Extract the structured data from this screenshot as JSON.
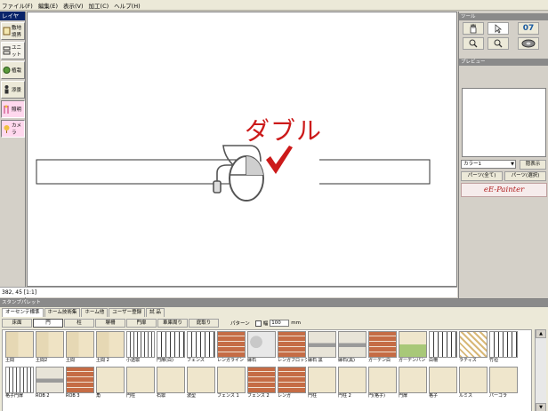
{
  "menu": [
    "ファイル(F)",
    "編集(E)",
    "表示(V)",
    "加工(C)",
    "ヘルプ(H)"
  ],
  "left_panel": {
    "title": "レイヤ",
    "tools": [
      {
        "label": "敷地境界",
        "icon": "site-icon"
      },
      {
        "label": "ユニット",
        "icon": "unit-icon"
      },
      {
        "label": "植栽",
        "icon": "plant-icon"
      },
      {
        "label": "添景",
        "icon": "figure-icon"
      },
      {
        "label": "照明",
        "icon": "light-icon"
      },
      {
        "label": "カメラ",
        "icon": "camera-icon"
      }
    ]
  },
  "canvas": {
    "annotation": "ダブル",
    "annotation_color": "#cc1a1a"
  },
  "status_bar": "382, 45 [1:1]",
  "right_panel": {
    "tools_title": "ツール",
    "zoom_value": "07",
    "preview_title": "プレビュー",
    "layer_select": "カラー1",
    "hide_button": "隠表示",
    "part_all_button": "パーツ(全て)",
    "part_select_button": "パーツ(選択)",
    "brand": "eE-Painter"
  },
  "stamp_panel": {
    "title": "スタンプパレット",
    "tabs": [
      "オーセンテ標準",
      "ホーム技術集",
      "ホーム他",
      "ユーザー登録",
      "試 品"
    ],
    "categories": [
      "床面",
      "門",
      "柱",
      "塀柵",
      "門扉",
      "車庫周り",
      "庭取り"
    ],
    "pattern_label": "パターン",
    "width_label": "幅",
    "width_value": "100",
    "unit": "mm",
    "stamps_row1": [
      {
        "label": "土間",
        "pattern": "p-tile"
      },
      {
        "label": "土間2",
        "pattern": "p-tile"
      },
      {
        "label": "土間",
        "pattern": "p-tile"
      },
      {
        "label": "土間 2",
        "pattern": "p-tile"
      },
      {
        "label": "小透塀",
        "pattern": "p-hatch"
      },
      {
        "label": "門扉(白)",
        "pattern": "p-fence"
      },
      {
        "label": "フェンス",
        "pattern": "p-fence"
      },
      {
        "label": "レンガライン",
        "pattern": "p-brick"
      },
      {
        "label": "縁石",
        "pattern": "p-stone"
      },
      {
        "label": "レンガブロック",
        "pattern": "p-brick"
      },
      {
        "label": "縁石 黒",
        "pattern": "p-gray"
      },
      {
        "label": "縁石(黒)",
        "pattern": "p-gray"
      },
      {
        "label": "ガーデン白",
        "pattern": "p-brick"
      },
      {
        "label": "ガーデンパン",
        "pattern": "p-green"
      },
      {
        "label": "白柵",
        "pattern": "p-fence"
      },
      {
        "label": "ラティス",
        "pattern": "p-lattice"
      },
      {
        "label": "竹垣",
        "pattern": "p-fence"
      }
    ],
    "stamps_row2": [
      {
        "label": "格子門扉",
        "pattern": "p-hatch"
      },
      {
        "label": "ROB 2",
        "pattern": "p-gray"
      },
      {
        "label": "ROB 3",
        "pattern": "p-brick"
      },
      {
        "label": "角",
        "pattern": "p-beige"
      },
      {
        "label": "門柱",
        "pattern": "p-beige"
      },
      {
        "label": "石塀",
        "pattern": "p-beige"
      },
      {
        "label": "波型",
        "pattern": "p-beige"
      },
      {
        "label": "フェンス 1",
        "pattern": "p-beige"
      },
      {
        "label": "フェンス 2",
        "pattern": "p-brick"
      },
      {
        "label": "レンガ",
        "pattern": "p-brick"
      },
      {
        "label": "門柱",
        "pattern": "p-beige"
      },
      {
        "label": "門柱 2",
        "pattern": "p-beige"
      },
      {
        "label": "門(格子)",
        "pattern": "p-beige"
      },
      {
        "label": "門扉",
        "pattern": "p-beige"
      },
      {
        "label": "格子",
        "pattern": "p-beige"
      },
      {
        "label": "ルミス",
        "pattern": "p-beige"
      },
      {
        "label": "パーゴラ",
        "pattern": "p-beige"
      }
    ]
  }
}
